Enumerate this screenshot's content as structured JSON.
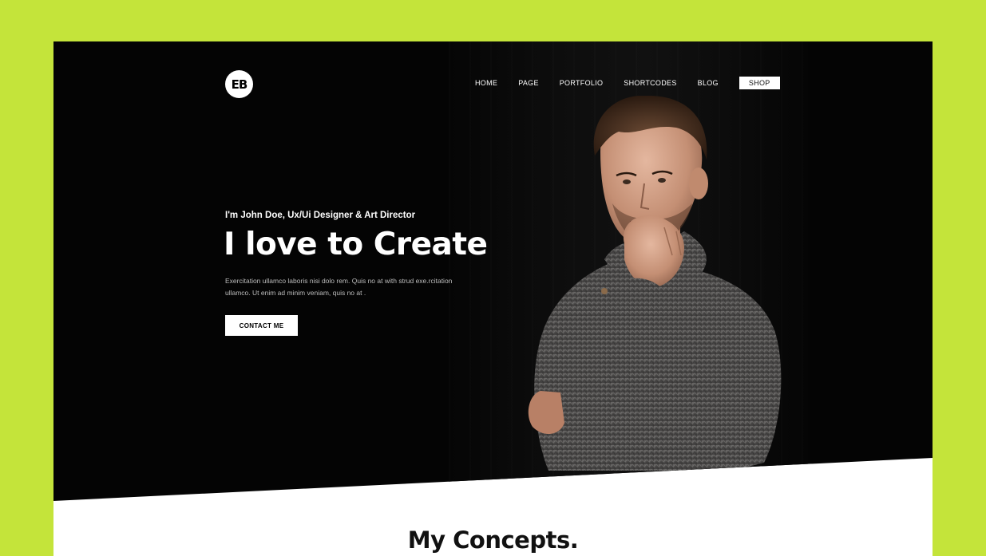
{
  "logo": {
    "text": "EB",
    "icon": "eb-logo-icon"
  },
  "nav": {
    "items": [
      {
        "label": "HOME"
      },
      {
        "label": "PAGE"
      },
      {
        "label": "PORTFOLIO"
      },
      {
        "label": "SHORTCODES"
      },
      {
        "label": "BLOG"
      },
      {
        "label": "SHOP"
      }
    ]
  },
  "hero": {
    "intro": "I'm John Doe, Ux/Ui Designer & Art Director",
    "headline": "I love to Create",
    "description": "Exercitation ullamco laboris nisi dolo rem. Quis no at with strud exe.rcitation ullamco. Ut enim ad minim veniam, quis no at .",
    "cta_label": "CONTACT ME"
  },
  "concepts": {
    "title": "My Concepts."
  },
  "colors": {
    "frame": "#c4e43a",
    "hero_bg": "#040404",
    "accent": "#ffffff"
  }
}
